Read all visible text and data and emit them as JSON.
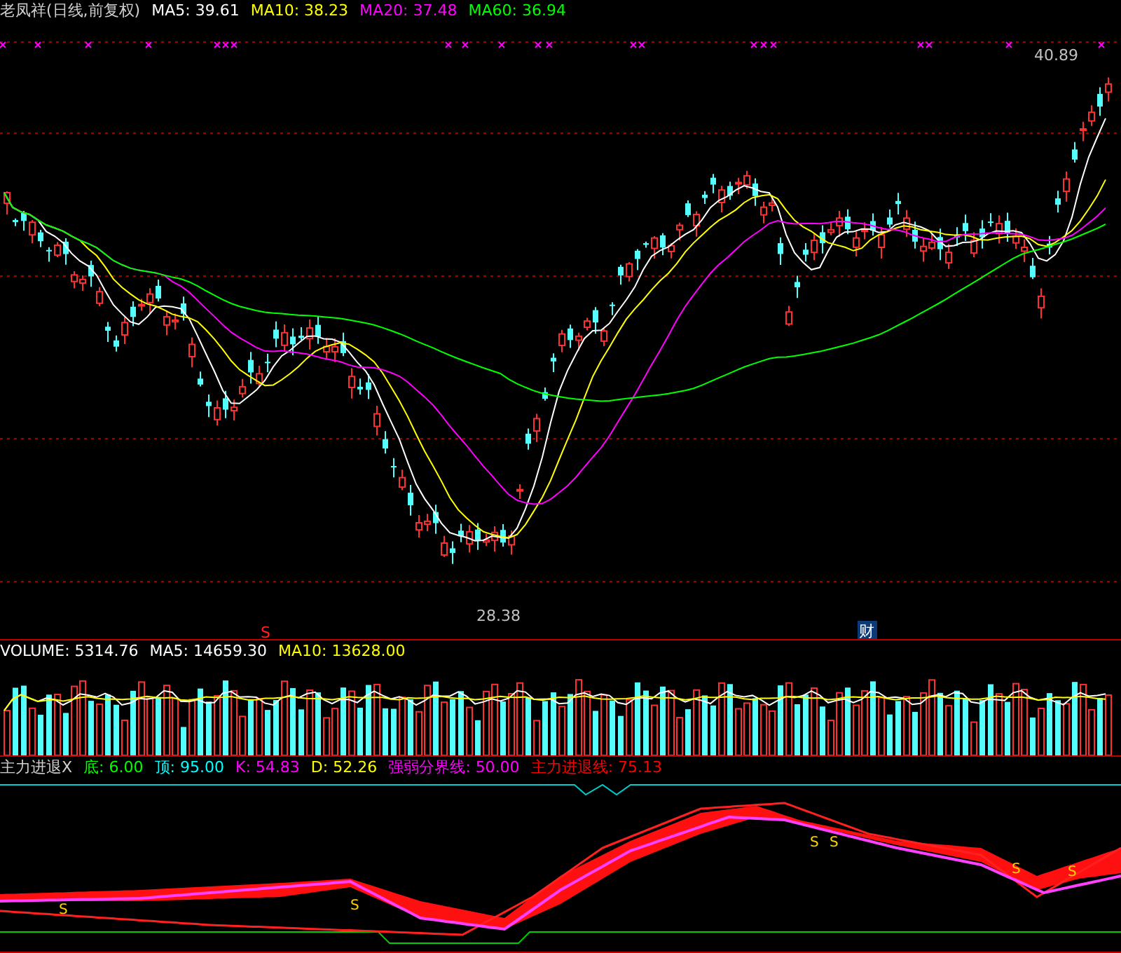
{
  "price_panel": {
    "title": "老凤祥(日线,前复权)",
    "indicators": [
      {
        "label": "MA5:",
        "value": "39.61",
        "color": "#ffffff"
      },
      {
        "label": "MA10:",
        "value": "38.23",
        "color": "#ffff00"
      },
      {
        "label": "MA20:",
        "value": "37.48",
        "color": "#ff00ff"
      },
      {
        "label": "MA60:",
        "value": "36.94",
        "color": "#00ff00"
      }
    ],
    "high_label": "40.89",
    "low_label": "28.38",
    "signal_mark": "S",
    "badge": "财"
  },
  "volume_panel": {
    "indicators": [
      {
        "label": "VOLUME:",
        "value": "5314.76",
        "color": "#ffffff"
      },
      {
        "label": "MA5:",
        "value": "14659.30",
        "color": "#ffffff"
      },
      {
        "label": "MA10:",
        "value": "13628.00",
        "color": "#ffff00"
      }
    ]
  },
  "indicator_panel": {
    "title": "主力进退X",
    "indicators": [
      {
        "label": "底:",
        "value": "6.00",
        "color": "#00ff00"
      },
      {
        "label": "顶:",
        "value": "95.00",
        "color": "#00ffff"
      },
      {
        "label": "K:",
        "value": "54.83",
        "color": "#ff00ff"
      },
      {
        "label": "D:",
        "value": "52.26",
        "color": "#ffff00"
      },
      {
        "label": "强弱分界线:",
        "value": "50.00",
        "color": "#ff00ff"
      },
      {
        "label": "主力进退线:",
        "value": "75.13",
        "color": "#ff0000"
      }
    ],
    "signals": [
      "S",
      "S",
      "S",
      "S",
      "S",
      "S"
    ]
  }
}
